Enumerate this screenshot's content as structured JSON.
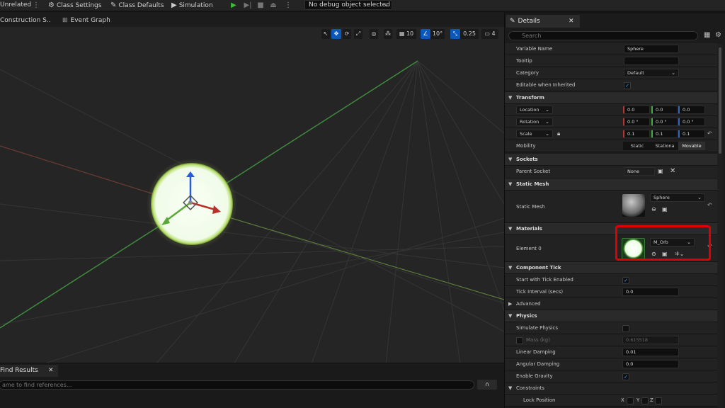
{
  "toolbar": {
    "unrelated_label": "Unrelated",
    "class_settings_label": "Class Settings",
    "class_defaults_label": "Class Defaults",
    "simulation_label": "Simulation",
    "debug_object": "No debug object selected"
  },
  "tabs": {
    "construction": "Construction S..",
    "event_graph": "Event Graph"
  },
  "viewport_toolbar": {
    "grid_snap": "10",
    "rotation_snap": "10°",
    "scale_snap": "0.25",
    "camera_speed": "4"
  },
  "find_results": {
    "tab_label": "Find Results",
    "placeholder": "ame to find references..."
  },
  "details": {
    "tab_label": "Details",
    "search_placeholder": "Search",
    "variable_name_label": "Variable Name",
    "variable_name_value": "Sphere",
    "tooltip_label": "Tooltip",
    "category_label": "Category",
    "category_value": "Default",
    "editable_label": "Editable when Inherited",
    "transform_header": "Transform",
    "location_label": "Location",
    "location": [
      "0.0",
      "0.0",
      "0.0"
    ],
    "rotation_label": "Rotation",
    "rotation": [
      "0.0 °",
      "0.0 °",
      "0.0 °"
    ],
    "scale_label": "Scale",
    "scale": [
      "0.1",
      "0.1",
      "0.1"
    ],
    "mobility_label": "Mobility",
    "mobility_options": [
      "Static",
      "Stationa",
      "Movable"
    ],
    "sockets_header": "Sockets",
    "parent_socket_label": "Parent Socket",
    "parent_socket_value": "None",
    "static_mesh_header": "Static Mesh",
    "static_mesh_label": "Static Mesh",
    "static_mesh_value": "Sphere",
    "materials_header": "Materials",
    "element0_label": "Element 0",
    "element0_value": "M_Orb",
    "component_tick_header": "Component Tick",
    "start_tick_label": "Start with Tick Enabled",
    "tick_interval_label": "Tick Interval (secs)",
    "tick_interval_value": "0.0",
    "advanced_label": "Advanced",
    "physics_header": "Physics",
    "simulate_physics_label": "Simulate Physics",
    "mass_label": "Mass (kg)",
    "mass_value": "0.615518",
    "linear_damping_label": "Linear Damping",
    "linear_damping_value": "0.01",
    "angular_damping_label": "Angular Damping",
    "angular_damping_value": "0.0",
    "enable_gravity_label": "Enable Gravity",
    "constraints_label": "Constraints",
    "lock_position_label": "Lock Position",
    "axis_x": "X",
    "axis_y": "Y",
    "axis_z": "Z"
  },
  "colors": {
    "accent": "#0a58b8",
    "highlight": "#e00000",
    "orb": "#f3fff0"
  }
}
